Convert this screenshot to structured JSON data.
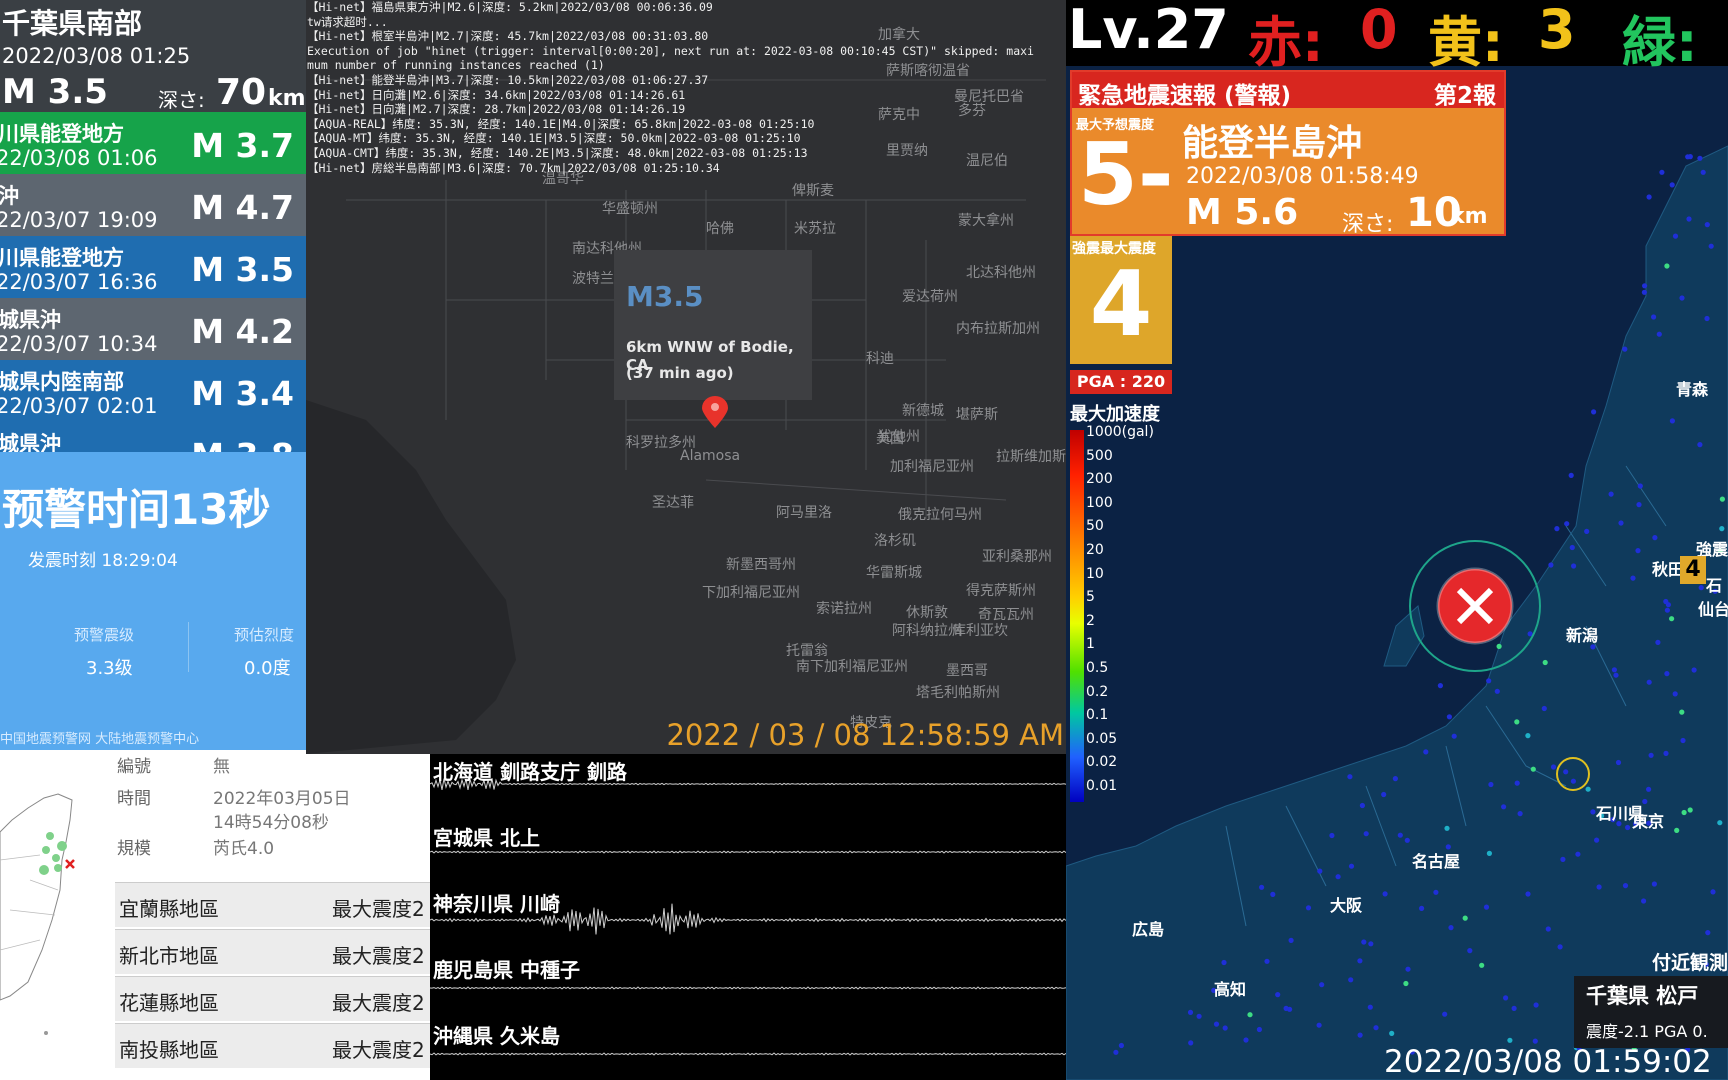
{
  "quake_list": {
    "header": {
      "area": "千葉県南部",
      "time": "2022/03/08  01:25",
      "mag": "M 3.5",
      "depth_label": "深さ:",
      "depth": "70",
      "depth_unit": "km"
    },
    "rows": [
      {
        "name": "川県能登地方",
        "time": "22/03/08  01:06",
        "mag": "M 3.7",
        "color": "#16a34a"
      },
      {
        "name": "沖",
        "time": "22/03/07  19:09",
        "mag": "M 4.7",
        "color": "#5d6670"
      },
      {
        "name": "川県能登地方",
        "time": "22/03/07  16:36",
        "mag": "M 3.5",
        "color": "#1f6db0"
      },
      {
        "name": "城県沖",
        "time": "22/03/07  10:34",
        "mag": "M 4.2",
        "color": "#5d6670"
      },
      {
        "name": "城県内陸南部",
        "time": "22/03/07  02:01",
        "mag": "M 3.4",
        "color": "#1f6db0"
      },
      {
        "name": "城県沖",
        "time": "",
        "mag": "M 3.8",
        "color": "#1f6db0"
      }
    ]
  },
  "china_warning": {
    "countdown": "预警时间13秒",
    "origin_time": "发震时刻 18:29:04",
    "mag_label": "预警震级",
    "mag_value": "3.3级",
    "intensity_label": "预估烈度",
    "intensity_value": "0.0度",
    "source": "中国地震预警网 大陆地震预警中心"
  },
  "taiwan": {
    "no_label": "編號",
    "no_value": "無",
    "time_label": "時間",
    "time_value_1": "2022年03月05日",
    "time_value_2": "14時54分08秒",
    "scale_label": "規模",
    "scale_value": "芮氏4.0",
    "regions": [
      {
        "name": "宜蘭縣地區",
        "value": "最大震度2"
      },
      {
        "name": "新北市地區",
        "value": "最大震度2"
      },
      {
        "name": "花蓮縣地區",
        "value": "最大震度2"
      },
      {
        "name": "南投縣地區",
        "value": "最大震度2"
      }
    ]
  },
  "world_map": {
    "log": "【Hi-net】福島県東方沖|M2.6|深度: 5.2km|2022/03/08 00:06:36.09\ntw请求超时...\n【Hi-net】根室半島沖|M2.7|深度: 45.7km|2022/03/08 00:31:03.80\nExecution of job \"hinet (trigger: interval[0:00:20], next run at: 2022-03-08 00:10:45 CST)\" skipped: maxi\nmum number of running instances reached (1)\n【Hi-net】能登半島沖|M3.7|深度: 10.5km|2022/03/08 01:06:27.37\n【Hi-net】日向灘|M2.6|深度: 34.6km|2022/03/08 01:14:26.61\n【Hi-net】日向灘|M2.7|深度: 28.7km|2022/03/08 01:14:26.19\n【AQUA-REAL】纬度: 35.3N, 经度: 140.1E|M4.0|深度: 65.8km|2022-03-08 01:25:10\n【AQUA-MT】纬度: 35.3N, 经度: 140.1E|M3.5|深度: 50.0km|2022-03-08 01:25:10\n【AQUA-CMT】纬度: 35.3N, 经度: 140.2E|M3.5|深度: 48.0km|2022-03-08 01:25:13\n【Hi-net】房総半島南部|M3.6|深度: 70.7km|2022/03/08 01:25:10.34",
    "tooltip_mag": "M3.5",
    "tooltip_place": "6km WNW of Bodie, CA",
    "tooltip_ago": "(37 min ago)",
    "timestamp": "2022 / 03 / 08 12:58:59 AM",
    "cities": [
      "加拿大",
      "萨斯喀彻温省",
      "曼尼托巴省",
      "萨克中",
      "里贾纳",
      "多芬",
      "温尼伯",
      "温哥华",
      "华盛顿州",
      "俾斯麦",
      "哈佛",
      "米苏拉",
      "蒙大拿州",
      "北达科他州",
      "南达科他州",
      "波特兰",
      "波特兰",
      "爱达荷州",
      "怀俄明州",
      "科迪",
      "内布拉斯加州",
      "丹佛",
      "新德城",
      "俄勒冈",
      "盐湖城",
      "犹他州",
      "堪萨斯",
      "美国",
      "科罗拉多州",
      "Alamosa",
      "加利福尼亚州",
      "拉斯维加斯",
      "圣达菲",
      "阿马里洛",
      "俄克拉何马州",
      "洛杉矶",
      "亚利桑那州",
      "新墨西哥州",
      "华雷斯城",
      "得克萨斯州",
      "下加利福尼亚州",
      "索诺拉州",
      "奇瓦瓦州",
      "休斯敦",
      "阿科纳拉州",
      "托雷翁",
      "南下加利福尼亚州",
      "库利亚坎",
      "墨西哥",
      "塔毛利帕斯州",
      "特皮克"
    ]
  },
  "waveforms": {
    "stations": [
      "北海道 釧路支庁 釧路",
      "宮城県 北上",
      "神奈川県 川崎",
      "鹿児島県 中種子",
      "沖縄県 久米島"
    ]
  },
  "japan": {
    "level": "Lv.27",
    "red_label": "赤:",
    "red_count": "0",
    "yellow_label": "黄:",
    "yellow_count": "3",
    "green_label": "緑:",
    "alert_title": "緊急地震速報 (警報)",
    "alert_report": "第2報",
    "max_intensity_label": "最大予想震度",
    "max_intensity": "5-",
    "area": "能登半島沖",
    "time": "2022/03/08 01:58:49",
    "mag": "M 5.6",
    "depth_label": "深さ:",
    "depth": "10",
    "depth_unit": "km",
    "strong_max_label": "強震最大震度",
    "strong_max": "4",
    "pga": "PGA : 220",
    "accel_title": "最大加速度",
    "scale_ticks": [
      "1000(gal)",
      "500",
      "200",
      "100",
      "50",
      "20",
      "10",
      "5",
      "2",
      "1",
      "0.5",
      "0.2",
      "0.1",
      "0.05",
      "0.02",
      "0.01"
    ],
    "city_labels": [
      "青森",
      "新潟",
      "東京",
      "名古屋",
      "大阪",
      "広島",
      "高知",
      "石川県",
      "強震",
      "石",
      "仙台",
      "秋田"
    ],
    "marker_value": "4",
    "nearby_label": "付近観測",
    "station_name": "千葉県 松戸",
    "station_values": "震度-2.1  PGA 0.",
    "timestamp": "2022/03/08 01:59:02",
    "colors": {
      "red": "#e02020",
      "yellow": "#f2c21a",
      "green": "#22c55e"
    }
  }
}
